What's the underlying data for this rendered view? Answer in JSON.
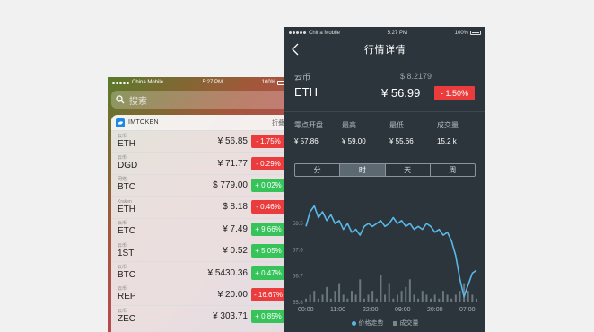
{
  "left_phone": {
    "status": {
      "carrier": "China Mobile",
      "time": "5:27 PM",
      "battery": "100%"
    },
    "search_placeholder": "搜索",
    "widget": {
      "app_name": "IMTOKEN",
      "collapse_label": "折叠",
      "rows": [
        {
          "exchange": "云币",
          "symbol": "ETH",
          "price": "¥ 56.85",
          "change": "- 1.75%",
          "dir": "down"
        },
        {
          "exchange": "云币",
          "symbol": "DGD",
          "price": "¥ 71.77",
          "change": "- 0.29%",
          "dir": "down"
        },
        {
          "exchange": "网络",
          "symbol": "BTC",
          "price": "$ 779.00",
          "change": "+ 0.02%",
          "dir": "up"
        },
        {
          "exchange": "Kraken",
          "symbol": "ETH",
          "price": "$ 8.18",
          "change": "- 0.46%",
          "dir": "down"
        },
        {
          "exchange": "云币",
          "symbol": "ETC",
          "price": "¥ 7.49",
          "change": "+ 9.66%",
          "dir": "up"
        },
        {
          "exchange": "云币",
          "symbol": "1ST",
          "price": "¥ 0.52",
          "change": "+ 5.05%",
          "dir": "up"
        },
        {
          "exchange": "云币",
          "symbol": "BTC",
          "price": "¥ 5430.36",
          "change": "+ 0.47%",
          "dir": "up"
        },
        {
          "exchange": "云币",
          "symbol": "REP",
          "price": "¥ 20.00",
          "change": "- 16.67%",
          "dir": "down"
        },
        {
          "exchange": "云币",
          "symbol": "ZEC",
          "price": "¥ 303.71",
          "change": "+ 0.85%",
          "dir": "up"
        }
      ]
    }
  },
  "right_phone": {
    "status": {
      "carrier": "China Mobile",
      "time": "5:27 PM",
      "battery": "100%"
    },
    "nav_title": "行情详情",
    "coin": {
      "exchange": "云币",
      "symbol": "ETH",
      "usd_price": "$ 8.2179",
      "cny_price": "¥ 56.99",
      "change": "- 1.50%"
    },
    "stats": [
      {
        "label": "零点开盘",
        "value": "¥ 57.86"
      },
      {
        "label": "最高",
        "value": "¥ 59.00"
      },
      {
        "label": "最低",
        "value": "¥ 55.66"
      },
      {
        "label": "成交量",
        "value": "15.2 k"
      }
    ],
    "tabs": [
      "分",
      "时",
      "天",
      "周"
    ],
    "active_tab": 1,
    "legend": {
      "price": "价格走势",
      "volume": "成交量"
    }
  },
  "colors": {
    "down": "#ea3c3c",
    "up": "#35c35a",
    "line": "#5ab8e8",
    "dark_bg": "#2b353b"
  },
  "chart_data": {
    "type": "line",
    "x_ticks": [
      "00:00",
      "11:00",
      "22:00",
      "09:00",
      "20:00",
      "07:00"
    ],
    "y_ticks": [
      "58.5",
      "57.6",
      "56.7",
      "55.8"
    ],
    "ylim": [
      55.8,
      59.3
    ],
    "series": [
      {
        "name": "价格走势",
        "values": [
          58.4,
          58.9,
          59.1,
          58.7,
          58.9,
          58.6,
          58.8,
          58.5,
          58.6,
          58.3,
          58.5,
          58.2,
          58.3,
          58.1,
          58.4,
          58.5,
          58.4,
          58.5,
          58.6,
          58.4,
          58.5,
          58.7,
          58.5,
          58.6,
          58.4,
          58.5,
          58.3,
          58.4,
          58.3,
          58.5,
          58.4,
          58.2,
          58.3,
          58.1,
          58.2,
          57.9,
          57.4,
          56.6,
          56.0,
          56.4,
          56.8,
          56.9
        ]
      },
      {
        "name": "成交量",
        "values": [
          1,
          2,
          3,
          1,
          2,
          4,
          1,
          3,
          5,
          2,
          1,
          3,
          2,
          6,
          1,
          2,
          3,
          1,
          7,
          2,
          5,
          1,
          2,
          3,
          4,
          6,
          2,
          1,
          3,
          2,
          1,
          2,
          1,
          3,
          2,
          1,
          2,
          3,
          5,
          3,
          2,
          1
        ]
      }
    ]
  }
}
